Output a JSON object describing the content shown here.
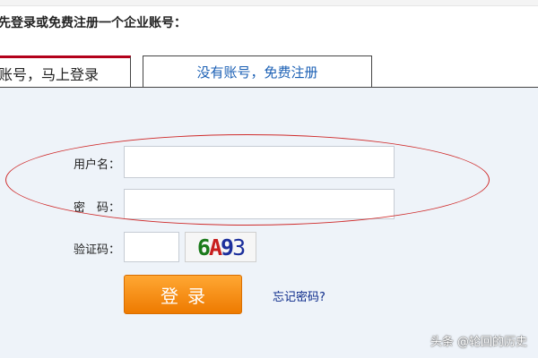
{
  "heading": "先登录或免费注册一个企业账号：",
  "tabs": {
    "active_label": "账号，马上登录",
    "inactive_label": "没有账号，免费注册"
  },
  "form": {
    "username_label": "用户名：",
    "username_value": "",
    "password_label": "密　码：",
    "password_value": "",
    "captcha_label": "验证码：",
    "captcha_value": "",
    "captcha_image": {
      "chars": [
        "6",
        "A",
        "9",
        "3"
      ],
      "colors": [
        "#1a7a1a",
        "#c81e1e",
        "#1c2f9c",
        "#1c2f9c"
      ]
    },
    "login_label": "登录",
    "forgot_label": "忘记密码?"
  },
  "annotation": {
    "oval_color": "#cf2b2b"
  },
  "watermark": "头条 @轮回的历史"
}
